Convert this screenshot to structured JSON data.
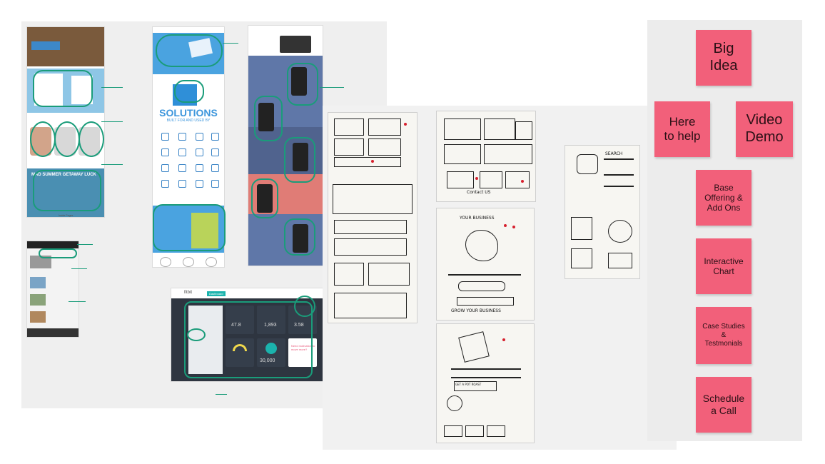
{
  "stickies": [
    {
      "key": "big-idea",
      "text": "Big\nIdea"
    },
    {
      "key": "here-to-help",
      "text": "Here\nto help"
    },
    {
      "key": "video-demo",
      "text": "Video\nDemo"
    },
    {
      "key": "base-offering",
      "text": "Base\nOffering &\nAdd Ons"
    },
    {
      "key": "interactive-chart",
      "text": "Interactive\nChart"
    },
    {
      "key": "case-studies",
      "text": "Case Studies\n&\nTestmonials"
    },
    {
      "key": "schedule-call",
      "text": "Schedule\na Call"
    }
  ],
  "screens": {
    "travel": {
      "headline": "MAD SUMMER GETAWAY LUCK",
      "caption": "Inside Pages"
    },
    "solutions": {
      "headline": "SOLUTIONS",
      "subline": "BUILT FOR AND USED BY"
    },
    "fitbit": {
      "logo": "fitbit",
      "nav_active": "Dashboard",
      "stat_1": "47.8",
      "stat_2": "1,893",
      "stat_3": "3.58",
      "stat_4": "30,000",
      "promo": "Need motivation to move more?"
    }
  },
  "sketches": {
    "contact": "Contact US",
    "search": "SEARCH",
    "business": "YOUR BUSINESS",
    "grow": "GROW YOUR BUSINESS",
    "get_pot": "GET A POT ROAST"
  },
  "colors": {
    "sticky": "#f2607a",
    "annotation": "#1a9c7a",
    "fitbit_teal": "#1bb3ad",
    "fitbit_dark": "#2e3540"
  }
}
